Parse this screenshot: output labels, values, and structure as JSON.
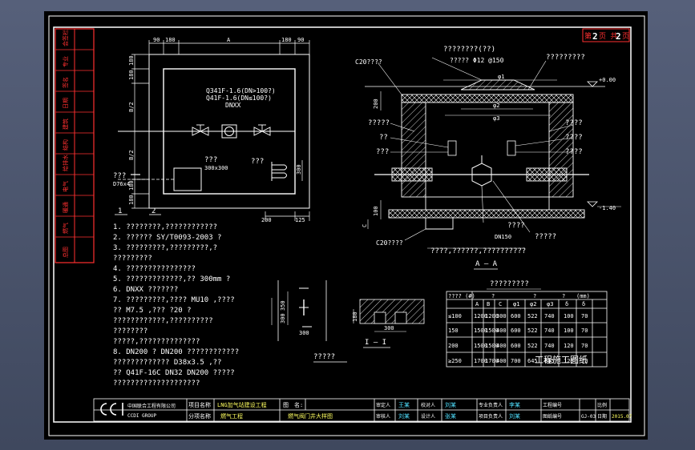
{
  "title_block": {
    "sheet": {
      "prefix": "第",
      "num": "2",
      "mid": "页 共",
      "total": "2",
      "suffix": "页"
    },
    "company_cn": "中国联合工程有限公司",
    "company_en": "CCDI GROUP",
    "project_name_label": "项目名称",
    "project_name": "LNG加气站建设工程",
    "subitem_label": "分项名称",
    "subitem": "燃气工程",
    "drawing_name_label": "图　名:",
    "drawing_name": "燃气阀门井大样图",
    "approver_label": "审定人",
    "approver": "王某",
    "reviewer_label": "审核人",
    "reviewer": "刘某",
    "checker_label": "校对人",
    "checker": "刘某",
    "designer_label": "设计人",
    "designer": "张某",
    "dept_head_label": "专业负责人",
    "dept_head": "李某",
    "proj_head_label": "项目负责人",
    "proj_head": "刘某",
    "drawing_no_label": "图纸编号",
    "drawing_no": "GJ-03",
    "scale_label": "比例",
    "date_label": "日期",
    "date": "2015.07",
    "proj_no_label": "工程编号"
  },
  "left_strip": [
    "会签栏",
    "专业",
    "签名",
    "日期",
    "建筑",
    "结构",
    "给排水",
    "电气",
    "暖通",
    "燃气",
    "总图"
  ],
  "plan": {
    "dim_top": [
      "90",
      "180",
      "A",
      "180",
      "90"
    ],
    "dim_left": [
      "180",
      "180",
      "B/2",
      "B/2",
      "180",
      "180"
    ],
    "valve_labels": [
      "Q341F-1.6(DN>100?)",
      "Q41F-1.6(DN≤100?)",
      "DNXX"
    ],
    "note_text": "???",
    "opening_text": "300x300",
    "drain_text": "???",
    "pipe_text": "???",
    "pipe_size": "D76x4",
    "dim_bottom": [
      "200",
      "125"
    ],
    "dim_right": "300",
    "label_1": "1",
    "label_2": "2"
  },
  "section": {
    "cover_label": "C20????",
    "top_mid_label": "????????(??)",
    "rebar_label": "?????  Φ12 @150",
    "top_right_label": "?????????",
    "elev_top": "+0.00",
    "elev_bottom": "-1.40",
    "d1": "φ1",
    "d2": "φ2",
    "d3": "φ3",
    "dim_200": "200",
    "dim_100": "100",
    "dim_c": "C",
    "left_labels": [
      "?????",
      "??",
      "???"
    ],
    "right_labels": [
      "????",
      "????",
      "????"
    ],
    "bottom_left": "C20????",
    "bottom_mid": "????",
    "pipe_label": "DN150",
    "pipe_right": "?????",
    "bottom_note": "????,??????,??????????",
    "caption": "A — A"
  },
  "notes": [
    "1.  ????????,????????????",
    "2.  ??????  SY/T0093-2003              ?",
    "3.  ?????????,?????????,?",
    "     ?????????",
    "4.  ????????????????",
    "5.  ?????????????,??     300mm    ?",
    "6.  DNXX       ???????",
    "7.  ?????????,????     MU10  ,????",
    "     ?? M7.5    ,??? ?20     ?",
    "     ????????????,??????????",
    "     ????????",
    "     ?????,??????????????",
    "8.  DN200 ? DN200        ????????????",
    "     ?????????????     D38x3.5     ,??",
    "     ??  Q41F-16C  DN32   DN200           ?????",
    "     ????????????????????"
  ],
  "detail1": {
    "dims": [
      "350",
      "300",
      "300"
    ],
    "caption": "?????"
  },
  "detail2": {
    "dims": [
      "300",
      "180"
    ],
    "caption": "I — I"
  },
  "table": {
    "title": "?????????",
    "unit": "(mm)",
    "header_group": [
      "?",
      "?",
      "?"
    ],
    "columns": [
      "????\n(#)",
      "A",
      "B",
      "C",
      "φ1",
      "φ2",
      "φ3",
      "δ",
      "δ"
    ],
    "rows": [
      [
        "≤100",
        "1200",
        "1200",
        "300",
        "600",
        "522",
        "740",
        "100",
        "70"
      ],
      [
        "150",
        "1500",
        "1500",
        "400",
        "600",
        "522",
        "740",
        "100",
        "70"
      ],
      [
        "200",
        "1500",
        "1500",
        "400",
        "600",
        "522",
        "740",
        "120",
        "70"
      ],
      [
        "≥250",
        "1700",
        "1700",
        "400",
        "700",
        "645",
        "895",
        "120",
        "70"
      ]
    ],
    "overlay": "工程施工图纸"
  }
}
